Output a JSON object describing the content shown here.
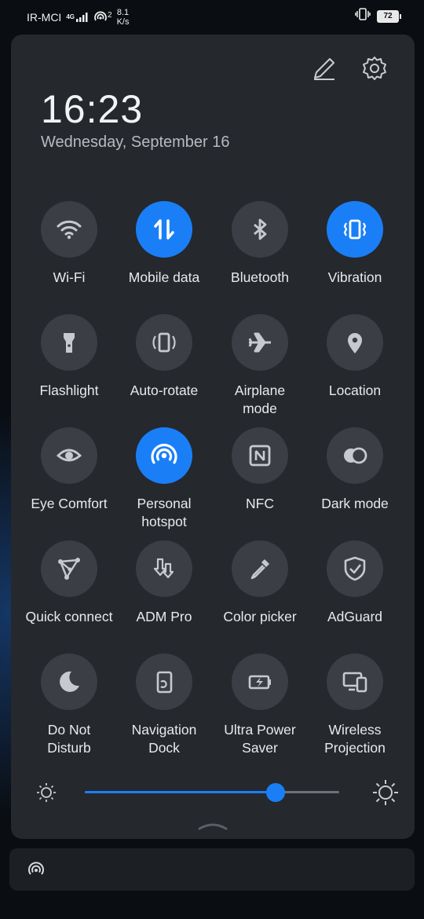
{
  "status_bar": {
    "carrier": "IR-MCI",
    "network_type": "4G",
    "hotspot_count": "2",
    "speed_value": "8.1",
    "speed_unit": "K/s",
    "battery": "72"
  },
  "panel": {
    "time": "16:23",
    "date": "Wednesday, September 16",
    "edit_icon": "pencil-icon",
    "settings_icon": "gear-icon"
  },
  "tiles": [
    {
      "label_lines": [
        "Wi-Fi"
      ],
      "icon": "wifi-icon",
      "active": false
    },
    {
      "label_lines": [
        "Mobile data"
      ],
      "icon": "mobile-data-icon",
      "active": true
    },
    {
      "label_lines": [
        "Bluetooth"
      ],
      "icon": "bluetooth-icon",
      "active": false
    },
    {
      "label_lines": [
        "Vibration"
      ],
      "icon": "vibration-icon",
      "active": true
    },
    {
      "label_lines": [
        "Flashlight"
      ],
      "icon": "flashlight-icon",
      "active": false
    },
    {
      "label_lines": [
        "Auto-rotate"
      ],
      "icon": "auto-rotate-icon",
      "active": false
    },
    {
      "label_lines": [
        "Airplane",
        "mode"
      ],
      "icon": "airplane-icon",
      "active": false
    },
    {
      "label_lines": [
        "Location"
      ],
      "icon": "location-icon",
      "active": false
    },
    {
      "label_lines": [
        "Eye Comfort"
      ],
      "icon": "eye-icon",
      "active": false
    },
    {
      "label_lines": [
        "Personal",
        "hotspot"
      ],
      "icon": "hotspot-icon",
      "active": true
    },
    {
      "label_lines": [
        "NFC"
      ],
      "icon": "nfc-icon",
      "active": false
    },
    {
      "label_lines": [
        "Dark mode"
      ],
      "icon": "dark-mode-icon",
      "active": false
    },
    {
      "label_lines": [
        "Quick connect"
      ],
      "icon": "quick-connect-icon",
      "active": false
    },
    {
      "label_lines": [
        "ADM Pro"
      ],
      "icon": "download-icon",
      "active": false
    },
    {
      "label_lines": [
        "Color picker"
      ],
      "icon": "color-picker-icon",
      "active": false
    },
    {
      "label_lines": [
        "AdGuard"
      ],
      "icon": "shield-icon",
      "active": false
    },
    {
      "label_lines": [
        "Do Not",
        "Disturb"
      ],
      "icon": "moon-icon",
      "active": false
    },
    {
      "label_lines": [
        "Navigation",
        "Dock"
      ],
      "icon": "navigation-dock-icon",
      "active": false
    },
    {
      "label_lines": [
        "Ultra Power",
        "Saver"
      ],
      "icon": "battery-saver-icon",
      "active": false
    },
    {
      "label_lines": [
        "Wireless",
        "Projection"
      ],
      "icon": "projection-icon",
      "active": false
    }
  ],
  "brightness": {
    "level_fraction": 0.75,
    "low_icon": "brightness-low-icon",
    "high_icon": "brightness-high-icon"
  },
  "colors": {
    "accent": "#1a7ff7",
    "tile_off": "#3b3e44",
    "panel": "#25282d"
  }
}
